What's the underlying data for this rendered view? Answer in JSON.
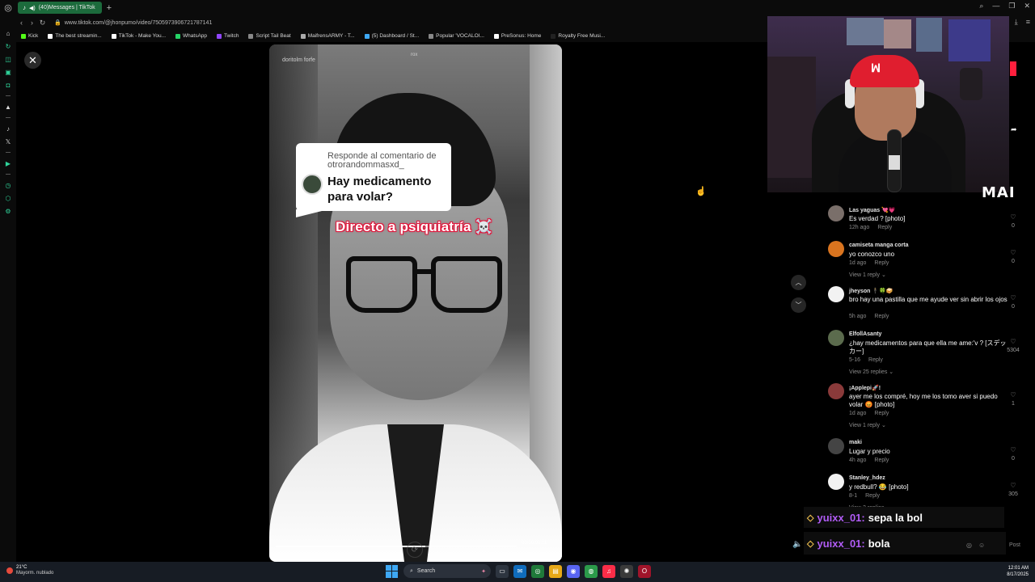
{
  "browser": {
    "tab_title": "(40)Messages | TikTok",
    "url": "www.tiktok.com/@jhonpumo/video/7505973906721787141",
    "bookmarks": [
      {
        "label": "Kick",
        "color": "#53fc18"
      },
      {
        "label": "The best streamin...",
        "color": "#ffffff"
      },
      {
        "label": "TikTok - Make You...",
        "color": "#ffffff"
      },
      {
        "label": "WhatsApp",
        "color": "#25d366"
      },
      {
        "label": "Twitch",
        "color": "#9146ff"
      },
      {
        "label": "Script Tail Beat",
        "color": "#888888"
      },
      {
        "label": "MaifrensARMY - T...",
        "color": "#aaaaaa"
      },
      {
        "label": "(5) Dashboard / St...",
        "color": "#3ea8f5"
      },
      {
        "label": "Popular 'VOCALOI...",
        "color": "#888888"
      },
      {
        "label": "PreSonus: Home",
        "color": "#ffffff"
      },
      {
        "label": "Royalty Free Musi...",
        "color": "#222222"
      }
    ]
  },
  "video": {
    "top_left_text": "doritolm forfe",
    "top_mid_text": "rox",
    "reply_card": {
      "prefix": "Responde al comentario de otrorandommasxd_",
      "question": "Hay medicamento para volar?"
    },
    "caption": "Directo a psiquiatría ☠️",
    "progress": 0.62,
    "time": "00:00/00:11"
  },
  "overlay": {
    "logo": "MAI"
  },
  "comments": [
    {
      "user": "Las yaguas 💘💗",
      "text": "Es verdad ? [photo]",
      "time": "12h ago",
      "reply": "Reply",
      "likes": "0",
      "replies": "",
      "avatar_color": "#7a6f6a"
    },
    {
      "user": "camiseta manga corta",
      "text": "yo conozco uno",
      "time": "1d ago",
      "reply": "Reply",
      "likes": "0",
      "replies": "View 1 reply",
      "avatar_color": "#d9741f"
    },
    {
      "user": "jheyson 🕴️🍀🥪",
      "text": "bro hay una pastilla que me ayude ver sin abrir los ojos",
      "time": "5h ago",
      "reply": "Reply",
      "likes": "0",
      "replies": "",
      "avatar_color": "#f2f2f2"
    },
    {
      "user": "ElfollAsanty",
      "text": "¿hay medicamentos para que ella me ame:'v ? [スデッカー]",
      "time": "5-16",
      "reply": "Reply",
      "likes": "5304",
      "replies": "View 25 replies",
      "avatar_color": "#5b6b4d"
    },
    {
      "user": "¡Applepi🚀!",
      "text": "ayer me los compré, hoy me los tomo aver si puedo volar 😡 [photo]",
      "time": "1d ago",
      "reply": "Reply",
      "likes": "1",
      "replies": "View 1 reply",
      "avatar_color": "#8a3a3a"
    },
    {
      "user": "maki",
      "text": "Lugar y precio",
      "time": "4h ago",
      "reply": "Reply",
      "likes": "0",
      "replies": "",
      "avatar_color": "#444444"
    },
    {
      "user": "Stanley_hdez",
      "text": "y redbull? 😂 [photo]",
      "time": "8-1",
      "reply": "Reply",
      "likes": "305",
      "replies": "View 2 replies",
      "avatar_color": "#f2f2f2"
    }
  ],
  "chat": [
    {
      "user": "yuixx_01:",
      "message": "sepa la bol"
    },
    {
      "user": "yuixx_01:",
      "message": "bola"
    }
  ],
  "comment_input": {
    "post_label": "Post"
  },
  "taskbar": {
    "temp": "21°C",
    "weather": "Mayorm. nublado",
    "search": "Search",
    "time": "12:01 AM",
    "date": "8/17/2025"
  }
}
